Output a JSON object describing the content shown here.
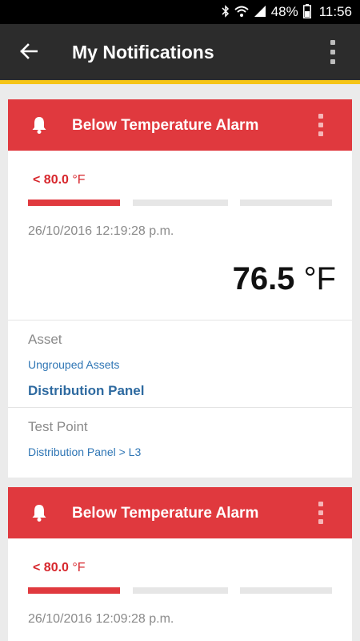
{
  "status_bar": {
    "battery_pct": "48%",
    "time": "11:56"
  },
  "app_bar": {
    "title": "My Notifications"
  },
  "colors": {
    "app_bar": "#2c2c2c",
    "accent": "#f5c518",
    "alarm_red": "#e0393e",
    "link_blue": "#2f76b5"
  },
  "notifications": [
    {
      "title": "Below Temperature Alarm",
      "threshold_value": "< 80.0",
      "threshold_unit": "°F",
      "timestamp": "26/10/2016 12:19:28 p.m.",
      "reading_value": "76.5",
      "reading_unit": "°F",
      "asset_label": "Asset",
      "asset_group": "Ungrouped Assets",
      "asset_name": "Distribution Panel",
      "test_point_label": "Test Point",
      "test_point_path": "Distribution Panel > L3"
    },
    {
      "title": "Below Temperature Alarm",
      "threshold_value": "< 80.0",
      "threshold_unit": "°F",
      "timestamp": "26/10/2016 12:09:28 p.m."
    }
  ]
}
